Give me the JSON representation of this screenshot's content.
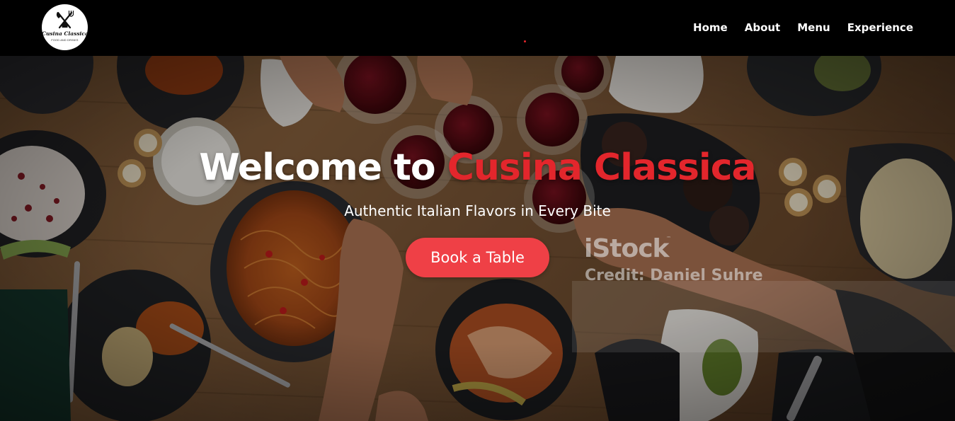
{
  "brand": {
    "name": "Cusina Classica",
    "tagline": "FOOD AND DRINKS",
    "logo_icon": "crossed-fork-knife-icon"
  },
  "nav": {
    "items": [
      {
        "label": "Home"
      },
      {
        "label": "About"
      },
      {
        "label": "Menu"
      },
      {
        "label": "Experience"
      }
    ]
  },
  "hero": {
    "title_prefix": "Welcome to ",
    "title_accent": "Cusina Classica",
    "subtitle": "Authentic Italian Flavors in Every Bite",
    "cta_label": "Book a Table",
    "background": "dinner-table-toast-photo"
  },
  "watermark": {
    "brand": "iStock",
    "trademark": "™",
    "credit": "Credit: Daniel Suhre"
  },
  "colors": {
    "accent": "#e3262c",
    "button": "#ef4046",
    "navbar": "#000000",
    "text": "#ffffff"
  }
}
